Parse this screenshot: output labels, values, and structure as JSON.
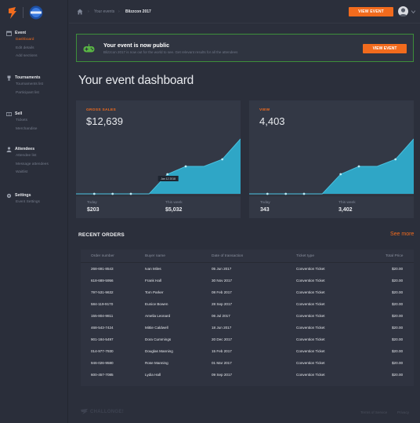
{
  "topbar": {
    "breadcrumbs": [
      "Your events",
      "Blizzcon 2017"
    ],
    "view_event_label": "VIEW EVENT"
  },
  "sidebar": {
    "sections": [
      {
        "title": "Event",
        "icon": "calendar-icon",
        "items": [
          {
            "label": "Dashboard",
            "active": true
          },
          {
            "label": "Edit details"
          },
          {
            "label": "Add sections"
          }
        ]
      },
      {
        "title": "Tournaments",
        "icon": "trophy-icon",
        "items": [
          {
            "label": "Tournaments list"
          },
          {
            "label": "Participant list"
          }
        ]
      },
      {
        "title": "Sell",
        "icon": "ticket-icon",
        "items": [
          {
            "label": "Tickets"
          },
          {
            "label": "Merchandise"
          }
        ]
      },
      {
        "title": "Attendees",
        "icon": "person-icon",
        "items": [
          {
            "label": "Attendee list"
          },
          {
            "label": "Message attendees"
          },
          {
            "label": "Waitlist"
          }
        ]
      },
      {
        "title": "Settings",
        "icon": "gear-icon",
        "items": [
          {
            "label": "Event Settings"
          }
        ]
      }
    ]
  },
  "banner": {
    "title": "Your event is now public",
    "subtitle": "Blizzcon 2017 is now out for the world to see. Get relevant results for all the attendees",
    "button_label": "VIEW EVENT",
    "border_color": "#3d8f3a"
  },
  "page_title": "Your event dashboard",
  "cards": [
    {
      "label": "GROSS SALES",
      "value": "$12,639",
      "today_label": "Today",
      "today_value": "$203",
      "week_label": "This week",
      "week_value": "$5,032",
      "tooltip": "Jan 12 2018"
    },
    {
      "label": "VIEW",
      "value": "4,403",
      "today_label": "Today",
      "today_value": "343",
      "week_label": "This week",
      "week_value": "3,402"
    }
  ],
  "chart_data": [
    {
      "type": "area",
      "title": "GROSS SALES",
      "values": [
        0,
        0,
        0,
        0,
        0,
        25,
        35,
        35,
        44,
        70
      ],
      "color": "#2fa6c6"
    },
    {
      "type": "area",
      "title": "VIEW",
      "values": [
        0,
        0,
        0,
        0,
        0,
        25,
        35,
        35,
        44,
        70
      ],
      "color": "#2fa6c6"
    }
  ],
  "orders": {
    "title": "RECENT ORDERS",
    "see_more": "See more",
    "columns": [
      "Order number",
      "Buyer name",
      "Date of transaction",
      "Ticket type",
      "Total Price"
    ],
    "rows": [
      [
        "268-691-8543",
        "Ivan Miles",
        "05 Jun 2017",
        "Convention Ticket",
        "$20.00"
      ],
      [
        "618-689-5956",
        "Frank Hall",
        "30 Nov 2017",
        "Convention Ticket",
        "$20.00"
      ],
      [
        "797-531-9632",
        "Tom Parker",
        "08 Feb 2017",
        "Convention Ticket",
        "$20.00"
      ],
      [
        "584-119-9170",
        "Eunice Bowen",
        "28 Sep 2017",
        "Convention Ticket",
        "$20.00"
      ],
      [
        "155-804-9811",
        "Amelia Leonard",
        "06 Jul 2017",
        "Convention Ticket",
        "$20.00"
      ],
      [
        "468-543-7424",
        "Mittie Caldwell",
        "18 Jun 2017",
        "Convention Ticket",
        "$20.00"
      ],
      [
        "901-184-5497",
        "Dora Cummings",
        "20 Dec 2017",
        "Convention Ticket",
        "$20.00"
      ],
      [
        "014-977-7930",
        "Douglas Manning",
        "15 Feb 2017",
        "Convention Ticket",
        "$20.00"
      ],
      [
        "946-026-9580",
        "Rose Manning",
        "01 Mar 2017",
        "Convention Ticket",
        "$20.00"
      ],
      [
        "600-457-7085",
        "Lydia Hall",
        "09 Sep 2017",
        "Convention Ticket",
        "$20.00"
      ]
    ]
  },
  "footer": {
    "brand": "CHALLONGE!",
    "links": [
      "Terms of Service",
      "Privacy"
    ]
  },
  "colors": {
    "accent": "#f26b1d",
    "chart": "#2fa6c6",
    "background": "#2b2f3b"
  }
}
